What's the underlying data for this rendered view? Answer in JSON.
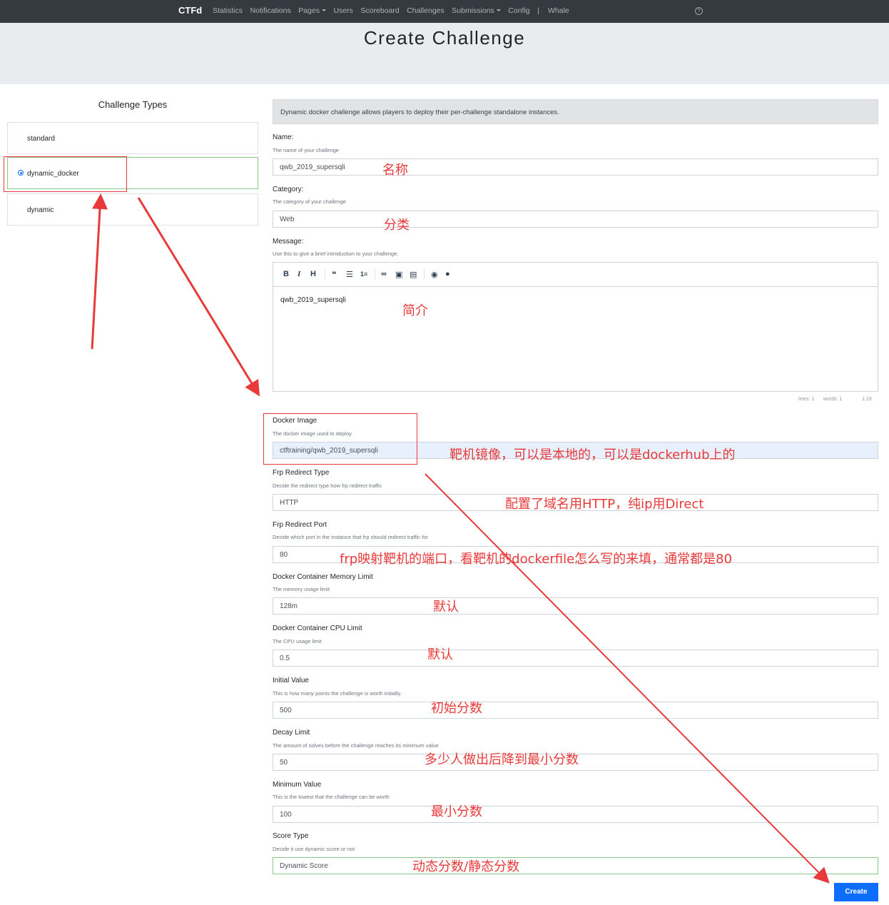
{
  "navbar": {
    "brand": "CTFd",
    "items": [
      "Statistics",
      "Notifications",
      "Pages",
      "Users",
      "Scoreboard",
      "Challenges",
      "Submissions",
      "Config",
      "Whale"
    ],
    "help_icon": "question-circle-icon"
  },
  "page": {
    "title": "Create Challenge"
  },
  "challenge_types": {
    "title": "Challenge Types",
    "items": [
      {
        "label": "standard",
        "selected": false
      },
      {
        "label": "dynamic_docker",
        "selected": true
      },
      {
        "label": "dynamic",
        "selected": false
      }
    ]
  },
  "form": {
    "description": "Dynamic docker challenge allows players to deploy their per-challenge standalone instances.",
    "name": {
      "label": "Name:",
      "help": "The name of your challenge",
      "value": "qwb_2019_supersqli"
    },
    "category": {
      "label": "Category:",
      "help": "The category of your challenge",
      "value": "Web"
    },
    "message": {
      "label": "Message:",
      "help": "Use this to give a brief introduction to your challenge.",
      "value": "qwb_2019_supersqli",
      "toolbar": [
        "bold-icon",
        "italic-icon",
        "heading-icon",
        "quote-icon",
        "unordered-list-icon",
        "ordered-list-icon",
        "link-icon",
        "image-icon",
        "file-icon",
        "preview-icon",
        "guide-icon"
      ],
      "status": {
        "lines": "lines: 1",
        "words": "words: 1",
        "cursor": "1:19"
      }
    },
    "docker_image": {
      "label": "Docker Image",
      "help": "The docker image used to deploy",
      "value": "ctftraining/qwb_2019_supersqli"
    },
    "frp_type": {
      "label": "Frp Redirect Type",
      "help": "Decide the redirect type how frp redirect traffic",
      "value": "HTTP"
    },
    "frp_port": {
      "label": "Frp Redirect Port",
      "help": "Decide which port in the instance that frp should redirect traffic for",
      "value": "80"
    },
    "memory": {
      "label": "Docker Container Memory Limit",
      "help": "The memory usage limit",
      "value": "128m"
    },
    "cpu": {
      "label": "Docker Container CPU Limit",
      "help": "The CPU usage limit",
      "value": "0.5"
    },
    "initial": {
      "label": "Initial Value",
      "help": "This is how many points the challenge is worth initially.",
      "value": "500"
    },
    "decay": {
      "label": "Decay Limit",
      "help": "The amount of solves before the challenge reaches its minimum value",
      "value": "50"
    },
    "minimum": {
      "label": "Minimum Value",
      "help": "This is the lowest that the challenge can be worth",
      "value": "100"
    },
    "score_type": {
      "label": "Score Type",
      "help": "Decide it use dynamic score or not",
      "value": "Dynamic Score"
    },
    "create_label": "Create"
  },
  "annotations": {
    "name": "名称",
    "category": "分类",
    "message": "简介",
    "docker_image": "靶机镜像，可以是本地的，可以是dockerhub上的",
    "frp_type": "配置了域名用HTTP，纯ip用Direct",
    "frp_port": "frp映射靶机的端口，看靶机的dockerfile怎么写的来填，通常都是80",
    "memory": "默认",
    "cpu": "默认",
    "initial": "初始分数",
    "decay": "多少人做出后降到最小分数",
    "minimum": "最小分数",
    "score_type": "动态分数/静态分数",
    "color": "#e83a3a"
  }
}
